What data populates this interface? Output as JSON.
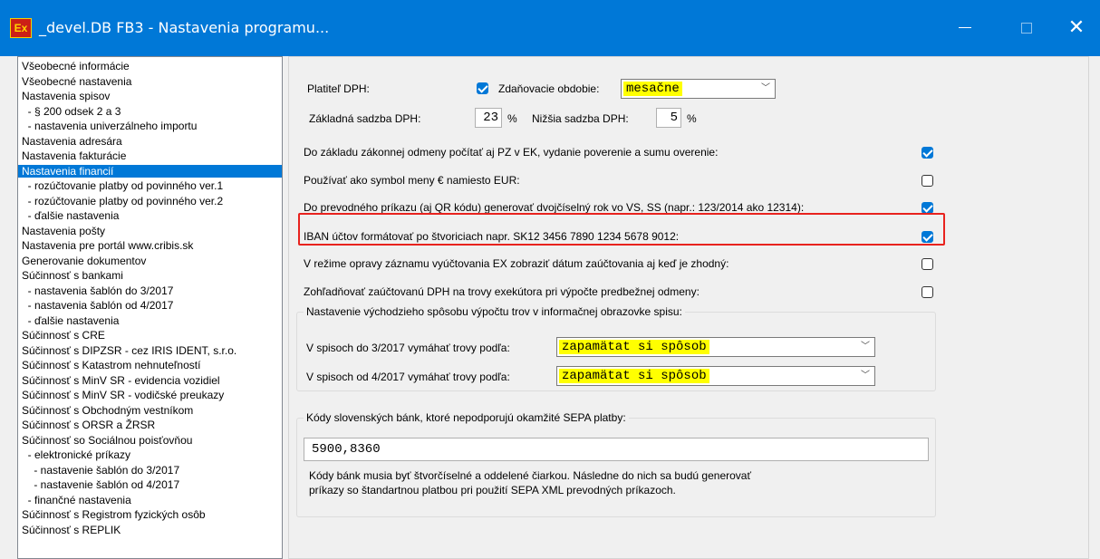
{
  "window": {
    "icon_label": "Ex",
    "title": "_devel.DB FB3 - Nastavenia programu...",
    "close_glyph": "✕"
  },
  "nav": {
    "items": [
      {
        "label": "Všeobecné informácie",
        "selected": false
      },
      {
        "label": "Všeobecné nastavenia",
        "selected": false
      },
      {
        "label": "Nastavenia spisov",
        "selected": false
      },
      {
        "label": "  - § 200 odsek 2 a 3",
        "selected": false
      },
      {
        "label": "  - nastavenia univerzálneho importu",
        "selected": false
      },
      {
        "label": "Nastavenia adresára",
        "selected": false
      },
      {
        "label": "Nastavenia fakturácie",
        "selected": false
      },
      {
        "label": "Nastavenia financií",
        "selected": true
      },
      {
        "label": "  - rozúčtovanie platby od povinného ver.1",
        "selected": false
      },
      {
        "label": "  - rozúčtovanie platby od povinného ver.2",
        "selected": false
      },
      {
        "label": "  - ďalšie nastavenia",
        "selected": false
      },
      {
        "label": "Nastavenia pošty",
        "selected": false
      },
      {
        "label": "Nastavenia pre portál www.cribis.sk",
        "selected": false
      },
      {
        "label": "Generovanie dokumentov",
        "selected": false
      },
      {
        "label": "Súčinnosť s bankami",
        "selected": false
      },
      {
        "label": "  - nastavenia šablón do 3/2017",
        "selected": false
      },
      {
        "label": "  - nastavenia šablón od 4/2017",
        "selected": false
      },
      {
        "label": "  - ďalšie nastavenia",
        "selected": false
      },
      {
        "label": "Súčinnosť s CRE",
        "selected": false
      },
      {
        "label": "Súčinnosť s DIPZSR - cez IRIS IDENT, s.r.o.",
        "selected": false
      },
      {
        "label": "Súčinnosť s Katastrom nehnuteľností",
        "selected": false
      },
      {
        "label": "Súčinnosť s MinV SR - evidencia vozidiel",
        "selected": false
      },
      {
        "label": "Súčinnosť s MinV SR - vodičské preukazy",
        "selected": false
      },
      {
        "label": "Súčinnosť s Obchodným vestníkom",
        "selected": false
      },
      {
        "label": "Súčinnosť s ORSR a ŽRSR",
        "selected": false
      },
      {
        "label": "Súčinnosť so Sociálnou poisťovňou",
        "selected": false
      },
      {
        "label": "  - elektronické príkazy",
        "selected": false
      },
      {
        "label": "    - nastavenie šablón do 3/2017",
        "selected": false
      },
      {
        "label": "    - nastavenie šablón od 4/2017",
        "selected": false
      },
      {
        "label": "  - finančné nastavenia",
        "selected": false
      },
      {
        "label": "Súčinnosť s Registrom fyzických osôb",
        "selected": false
      },
      {
        "label": "Súčinnosť s REPLIK",
        "selected": false
      }
    ]
  },
  "settings": {
    "vat_payer_label": "Platiteľ DPH:",
    "vat_payer_checked": true,
    "tax_period_label": "Zdaňovacie obdobie:",
    "tax_period_value": "mesačne",
    "base_rate_label": "Základná sadzba DPH:",
    "base_rate_value": "23",
    "percent": "%",
    "lower_rate_label": "Nižšia sadzba DPH:",
    "lower_rate_value": "5",
    "options": [
      {
        "label": "Do základu zákonnej odmeny počítať aj PZ v EK, vydanie poverenie a sumu overenie:",
        "checked": true
      },
      {
        "label": "Používať ako symbol meny € namiesto EUR:",
        "checked": false
      },
      {
        "label": "Do prevodného príkazu (aj QR kódu) generovať dvojčíselný rok vo VS, SS (napr.: 123/2014 ako 12314):",
        "checked": true
      },
      {
        "label": "IBAN účtov formátovať po štvoriciach napr. SK12 3456 7890 1234 5678 9012:",
        "checked": true
      },
      {
        "label": "V režime opravy záznamu vyúčtovania EX zobraziť dátum zaúčtovania aj keď je zhodný:",
        "checked": false
      },
      {
        "label": "Zohľadňovať zaúčtovanú DPH na trovy exekútora pri výpočte predbežnej odmeny:",
        "checked": false
      }
    ],
    "costs_group_title": "Nastavenie východzieho spôsobu výpočtu trov v informačnej obrazovke spisu:",
    "costs_before_label": "V spisoch do 3/2017 vymáhať trovy podľa:",
    "costs_before_value": "zapamätat si spôsob",
    "costs_after_label": "V spisoch od 4/2017 vymáhať trovy podľa:",
    "costs_after_value": "zapamätat si spôsob",
    "sepa_group_title": "Kódy slovenských bánk, ktoré nepodporujú okamžité SEPA platby:",
    "sepa_codes": "5900,8360",
    "sepa_note": "Kódy bánk musia byť štvorčíselné a oddelené čiarkou.  Následne do nich sa budú generovať príkazy so štandartnou platbou pri použití SEPA XML prevodných príkazoch.",
    "dropdown_arrow": "﹀"
  },
  "colors": {
    "titlebar": "#0078d7",
    "selection": "#0078d7",
    "combo_highlight": "#ffff00",
    "callout": "#e8231e"
  }
}
